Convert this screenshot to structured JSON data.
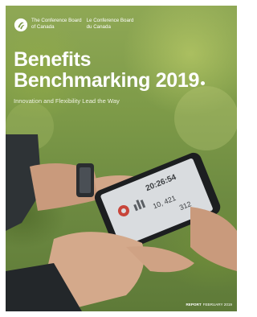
{
  "org": {
    "name_en_line1": "The Conference Board",
    "name_en_line2": "of Canada",
    "name_fr_line1": "Le Conference Board",
    "name_fr_line2": "du Canada"
  },
  "title": {
    "line1": "Benefits",
    "line2": "Benchmarking 2019"
  },
  "subtitle": "Innovation and Flexibility Lead the Way",
  "footer": {
    "label": "REPORT",
    "date": "FEBRUARY 2019"
  },
  "phone_screen": {
    "time": "20:26:54",
    "stat1": "10, 421",
    "stat2": "312"
  },
  "colors": {
    "background": "#7d9a48",
    "text": "#ffffff"
  },
  "icons": [
    "conference-board-logo-icon",
    "donut-chart-icon",
    "bar-chart-icon"
  ]
}
